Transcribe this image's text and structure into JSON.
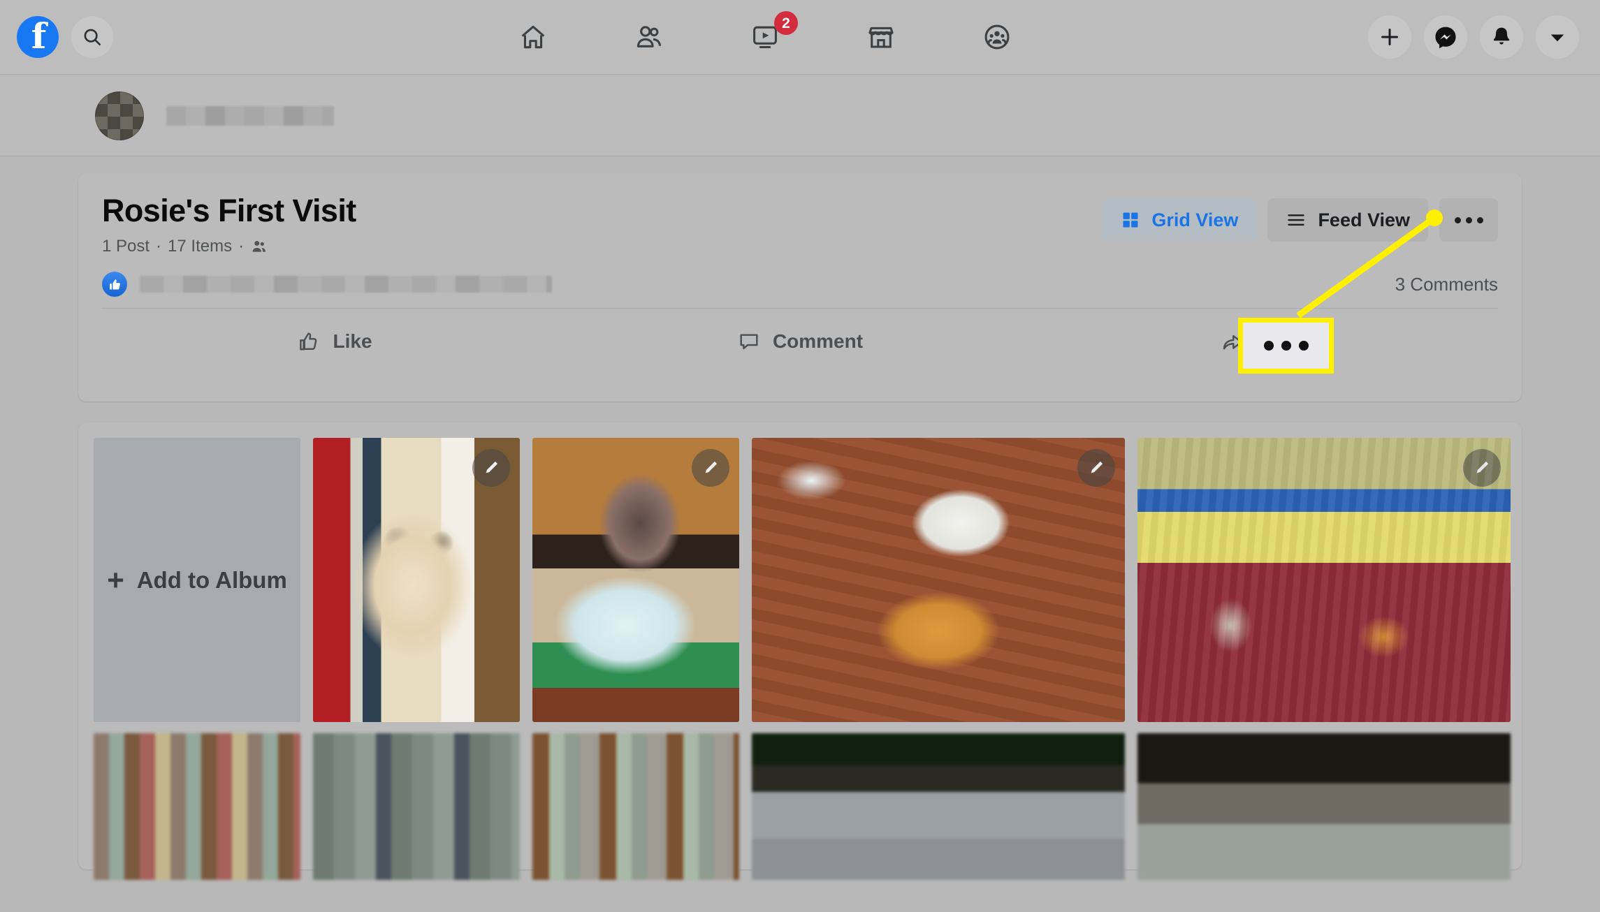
{
  "topbar": {
    "logo_icon": "facebook-logo",
    "search_icon": "search-icon",
    "nav_items": [
      {
        "id": "home",
        "icon": "home-icon",
        "label": "Home",
        "badge": ""
      },
      {
        "id": "friends",
        "icon": "friends-icon",
        "label": "Friends",
        "badge": ""
      },
      {
        "id": "watch",
        "icon": "watch-video-icon",
        "label": "Watch",
        "badge": "2"
      },
      {
        "id": "marketplace",
        "icon": "marketplace-store-icon",
        "label": "Marketplace",
        "badge": ""
      },
      {
        "id": "groups",
        "icon": "groups-icon",
        "label": "Groups",
        "badge": ""
      }
    ],
    "right_items": [
      {
        "id": "create",
        "icon": "plus-icon",
        "label": "Create"
      },
      {
        "id": "messenger",
        "icon": "messenger-icon",
        "label": "Messenger"
      },
      {
        "id": "notifications",
        "icon": "bell-icon",
        "label": "Notifications"
      },
      {
        "id": "account",
        "icon": "chevron-down-icon",
        "label": "Account"
      }
    ]
  },
  "profile_strip": {
    "avatar_icon": "user-avatar",
    "name": ""
  },
  "album": {
    "title": "Rosie's First Visit",
    "meta": {
      "posts": "1 Post",
      "separator": "·",
      "items": "17 Items",
      "audience_icon": "friends-audience-icon"
    },
    "view_buttons": {
      "grid_label": "Grid View",
      "grid_icon": "grid-icon",
      "feed_label": "Feed View",
      "feed_icon": "list-lines-icon",
      "more_icon": "ellipsis-icon"
    },
    "reactions": {
      "like_icon": "like-thumb-badge",
      "names": "",
      "comments": "3 Comments"
    },
    "actions": [
      {
        "id": "like",
        "label": "Like",
        "icon": "thumbs-up-icon"
      },
      {
        "id": "comment",
        "label": "Comment",
        "icon": "comment-bubble-icon"
      },
      {
        "id": "share",
        "label": "Share",
        "icon": "share-arrow-icon"
      }
    ]
  },
  "grid": {
    "add_tile": {
      "plus": "+",
      "label": "Add to Album"
    },
    "photos": [
      {
        "id": "photo-1",
        "alt": "Cream labradoodle sitting indoors",
        "edit_icon": "pencil-edit-icon"
      },
      {
        "id": "photo-2",
        "alt": "Person in green shirt holding white poodle puppy",
        "edit_icon": "pencil-edit-icon"
      },
      {
        "id": "photo-3",
        "alt": "White poodle puppy meeting orange tabby cat on brick floor",
        "edit_icon": "pencil-edit-icon"
      },
      {
        "id": "photo-4",
        "alt": "White puppy and orange cat on hardwood bedroom floor",
        "edit_icon": "pencil-edit-icon"
      }
    ],
    "blurred_row": [
      {
        "id": "photo-5"
      },
      {
        "id": "photo-6"
      },
      {
        "id": "photo-7"
      },
      {
        "id": "photo-8"
      },
      {
        "id": "photo-9"
      }
    ]
  },
  "annotation": {
    "callout_icon": "ellipsis-icon",
    "highlight_color": "#ffef00",
    "dot_color": "#ffef00"
  },
  "colors": {
    "page_bg": "#b8b8b8",
    "card_bg": "#bbbbbb",
    "brand_blue": "#1877f2",
    "link_blue": "#1b74e4",
    "badge_red": "#d32c3e",
    "text_primary": "#0b0b0b",
    "text_secondary": "#4f5356"
  }
}
